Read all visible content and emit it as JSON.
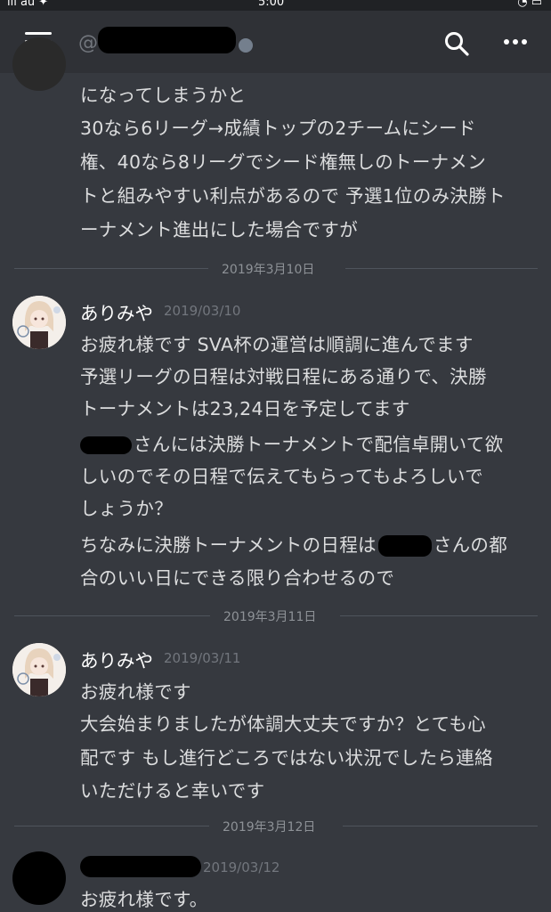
{
  "status_bar": {
    "carrier": "ıll au ✦",
    "time": "5:00",
    "indicators": "◔ ▭"
  },
  "header": {
    "at_symbol": "@",
    "icons": {
      "menu": "hamburger-menu-icon",
      "search": "search-icon",
      "more": "more-options-icon"
    }
  },
  "messages_top": {
    "lines": [
      "になってしまうかと",
      "30なら6リーグ→成績トップの2チームにシード",
      "権、40なら8リーグでシード権無しのトーナメン",
      "トと組みやすい利点があるので 予選1位のみ決勝ト",
      "ーナメント進出にした場合ですが"
    ]
  },
  "dividers": [
    "2019年3月10日",
    "2019年3月11日",
    "2019年3月12日"
  ],
  "group1": {
    "author": "ありみや",
    "timestamp": "2019/03/10",
    "lines": [
      "お疲れ様です SVA杯の運営は順調に進んでます",
      "予選リーグの日程は対戦日程にある通りで、決勝",
      "トーナメントは23,24日を予定してます",
      "さんには決勝トーナメントで配信卓開いて欲",
      "しいのでその日程で伝えてもらってもよろしいで",
      "しょうか？",
      "ちなみに決勝トーナメントの日程は",
      "さんの都",
      "合のいい日にできる限り合わせるので"
    ]
  },
  "group2": {
    "author": "ありみや",
    "timestamp": "2019/03/11",
    "lines": [
      "お疲れ様です",
      "大会始まりましたが体調大丈夫ですか？とても心",
      "配です もし進行どころではない状況でしたら連絡",
      "いただけると幸いです"
    ]
  },
  "group3": {
    "timestamp": "2019/03/12",
    "lines": [
      "お疲れ様です。"
    ]
  }
}
